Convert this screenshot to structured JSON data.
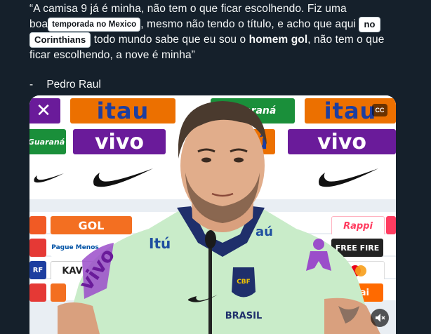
{
  "tweet": {
    "line1": "“A camisa 9 já é minha, não tem o que ficar escolhendo. Fiz uma",
    "boa": "boa",
    "pill_temporada": "temporada no Mexico",
    "mid2": ", mesmo não tendo o título, e acho que aqui",
    "pill_no": "no",
    "pill_corinthians": "Corinthians",
    "mid3": " todo mundo sabe que eu sou o ",
    "bold_phrase": "homem gol",
    "end3": ", não tem o que",
    "line4": "ficar escolhendo, a nove é minha”"
  },
  "signature": {
    "dash": "-",
    "author": "Pedro Raul"
  },
  "media": {
    "cc_label": "CC",
    "sponsors": {
      "itau": "itau",
      "guarana": "Guaraná",
      "vivo": "vivo",
      "gol": "GOL",
      "rappi": "Rappi",
      "freefire": "FREE FIRE",
      "kwai": "kwai",
      "kav": "KAV",
      "pague": "Pague Menos"
    },
    "jersey": {
      "brand_left": "Itú",
      "brand_right": "aú",
      "sleeve": "vivo",
      "crest_text": "CBF",
      "country": "BRASIL"
    }
  },
  "colors": {
    "background": "#15202b",
    "text": "#f7f9f9",
    "jersey": "#c9ecc9",
    "collar": "#1f2f6b"
  },
  "icons": {
    "captions": "closed-captions-icon",
    "sound": "speaker-muted-icon"
  }
}
